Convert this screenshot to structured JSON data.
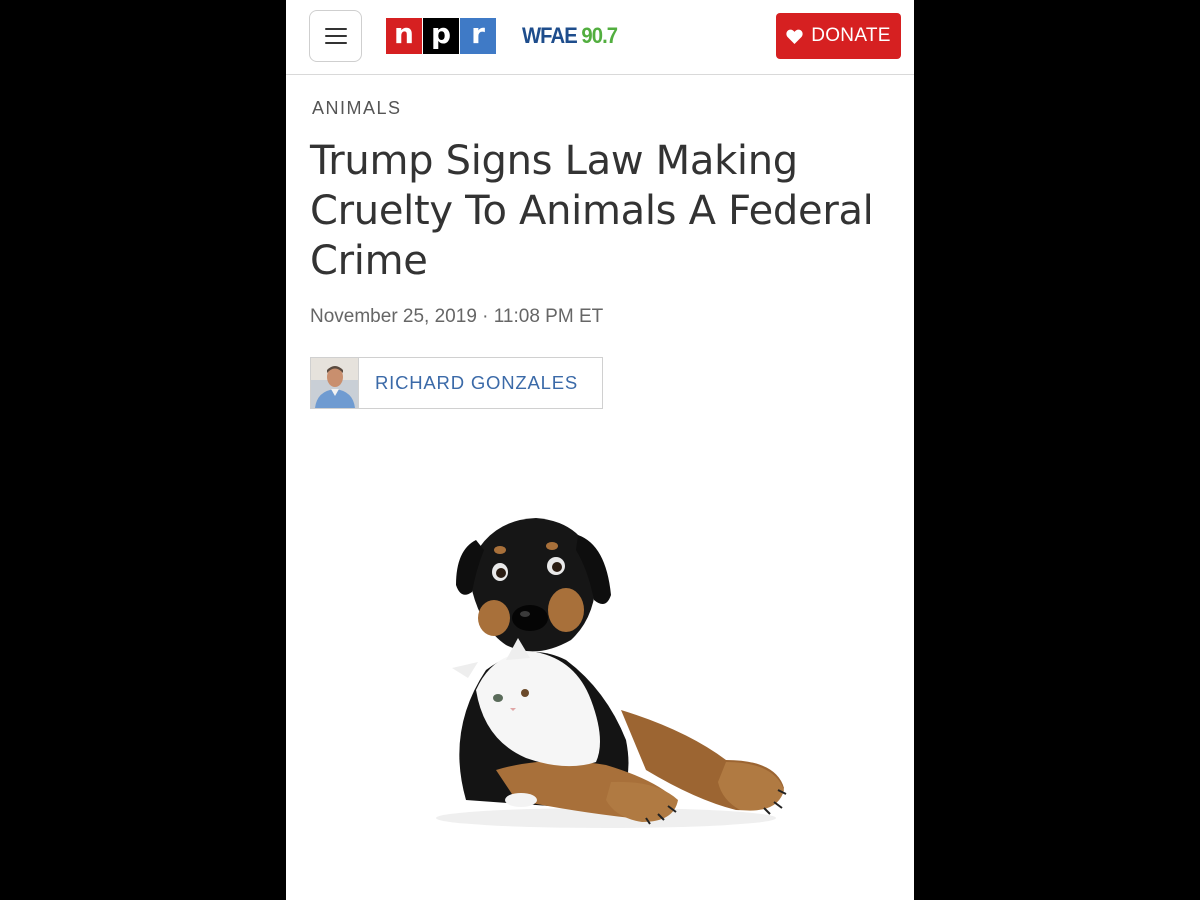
{
  "header": {
    "menu_icon": "hamburger-menu-icon",
    "npr_letters": [
      "n",
      "p",
      "r"
    ],
    "station_call": "WFAE",
    "station_freq": "90.7",
    "donate_label": "DONATE",
    "donate_icon": "heart-icon"
  },
  "article": {
    "section": "ANIMALS",
    "headline": "Trump Signs Law Making Cruelty To Animals A Federal Crime",
    "date": "November 25, 2019 · 11:08 PM ET",
    "author": "RICHARD GONZALES"
  },
  "colors": {
    "npr_red": "#d62021",
    "npr_black": "#000000",
    "npr_blue": "#3f7ac6",
    "station_blue": "#1e4d8c",
    "station_green": "#52ae3f",
    "author_link": "#3b6aa8"
  }
}
